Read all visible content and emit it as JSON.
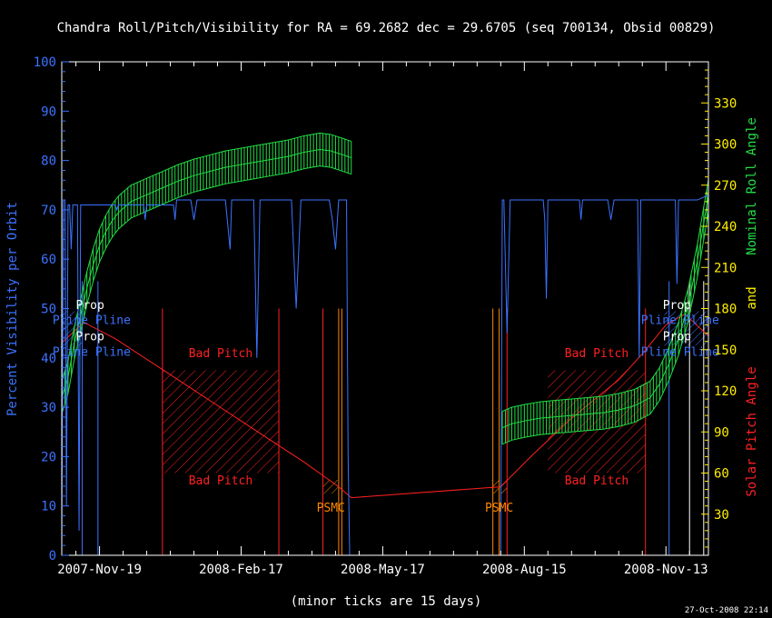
{
  "chart_data": {
    "type": "line",
    "title": "Chandra Roll/Pitch/Visibility for RA = 69.2682 dec = 29.6705 (seq 700134, Obsid 00829)",
    "xlabel": "(minor ticks are 15 days)",
    "ylabel_left": "Percent Visibility per Orbit",
    "ylabel_right_1": "Nominal Roll Angle",
    "ylabel_right_2": "and",
    "ylabel_right_3": "Solar Pitch Angle",
    "timestamp": "27-Oct-2008 22:14",
    "x_range_days": [
      -24,
      387
    ],
    "x_ticks": [
      {
        "label": "2007-Nov-19",
        "day": 0
      },
      {
        "label": "2008-Feb-17",
        "day": 90
      },
      {
        "label": "2008-May-17",
        "day": 180
      },
      {
        "label": "2008-Aug-15",
        "day": 270
      },
      {
        "label": "2008-Nov-13",
        "day": 360
      }
    ],
    "y_left": {
      "range": [
        0,
        100
      ],
      "ticks": [
        0,
        10,
        20,
        30,
        40,
        50,
        60,
        70,
        80,
        90,
        100
      ]
    },
    "y_right": {
      "range": [
        0,
        360
      ],
      "ticks": [
        30,
        60,
        90,
        120,
        150,
        180,
        210,
        240,
        270,
        300,
        330
      ]
    },
    "colors": {
      "axes": "#ffffff",
      "visibility": "#3b73ff",
      "roll": "#22dd44",
      "right_ticks": "#ffee00",
      "pitch": "#ff2020",
      "psmc": "#ff8800",
      "prop": "#ffffff",
      "pline": "#3b73ff"
    },
    "series": [
      {
        "name": "Percent Visibility per Orbit",
        "axis": "left",
        "points": [
          [
            -24,
            0
          ],
          [
            -23,
            72
          ],
          [
            -22,
            72
          ],
          [
            -21,
            10
          ],
          [
            -20,
            71
          ],
          [
            -19,
            71
          ],
          [
            -18,
            62
          ],
          [
            -17,
            71
          ],
          [
            -14,
            71
          ],
          [
            -13,
            5
          ],
          [
            -12,
            71
          ],
          [
            10,
            71
          ],
          [
            11,
            70
          ],
          [
            12,
            71
          ],
          [
            28,
            71
          ],
          [
            29,
            68
          ],
          [
            30,
            71
          ],
          [
            47,
            71
          ],
          [
            48,
            68
          ],
          [
            49,
            72
          ],
          [
            58,
            72
          ],
          [
            60,
            68
          ],
          [
            62,
            72
          ],
          [
            80,
            72
          ],
          [
            83,
            62
          ],
          [
            84,
            72
          ],
          [
            98,
            72
          ],
          [
            100,
            40
          ],
          [
            102,
            72
          ],
          [
            122,
            72
          ],
          [
            125,
            50
          ],
          [
            128,
            72
          ],
          [
            146,
            72
          ],
          [
            148,
            68
          ],
          [
            150,
            62
          ],
          [
            152,
            72
          ],
          [
            157,
            72
          ],
          [
            158,
            20
          ],
          [
            159,
            0
          ],
          [
            160,
            0
          ],
          [
            255,
            0
          ],
          [
            256,
            72
          ],
          [
            257,
            72
          ],
          [
            259,
            45
          ],
          [
            261,
            72
          ],
          [
            265,
            72
          ],
          [
            267,
            72
          ],
          [
            282,
            72
          ],
          [
            283,
            68
          ],
          [
            284,
            52
          ],
          [
            285,
            72
          ],
          [
            305,
            72
          ],
          [
            306,
            68
          ],
          [
            307,
            72
          ],
          [
            323,
            72
          ],
          [
            325,
            68
          ],
          [
            327,
            72
          ],
          [
            342,
            72
          ],
          [
            343,
            40
          ],
          [
            344,
            72
          ],
          [
            366,
            72
          ],
          [
            367,
            55
          ],
          [
            368,
            72
          ],
          [
            372,
            72
          ],
          [
            380,
            72
          ],
          [
            387,
            73
          ]
        ]
      },
      {
        "name": "Nominal Roll Angle",
        "axis": "right",
        "points": [
          [
            -24,
            115
          ],
          [
            -20,
            130
          ],
          [
            -16,
            155
          ],
          [
            -12,
            175
          ],
          [
            -8,
            195
          ],
          [
            -4,
            212
          ],
          [
            0,
            226
          ],
          [
            4,
            236
          ],
          [
            8,
            244
          ],
          [
            12,
            250
          ],
          [
            16,
            254
          ],
          [
            20,
            258
          ],
          [
            30,
            263
          ],
          [
            40,
            268
          ],
          [
            50,
            273
          ],
          [
            60,
            277
          ],
          [
            70,
            280
          ],
          [
            80,
            283
          ],
          [
            90,
            285
          ],
          [
            100,
            287
          ],
          [
            110,
            289
          ],
          [
            120,
            291
          ],
          [
            130,
            294
          ],
          [
            140,
            296
          ],
          [
            147,
            295
          ],
          [
            155,
            292
          ],
          [
            160,
            290
          ],
          [
            256,
            93
          ],
          [
            262,
            96
          ],
          [
            270,
            98
          ],
          [
            280,
            100
          ],
          [
            290,
            101
          ],
          [
            300,
            102
          ],
          [
            310,
            103
          ],
          [
            320,
            104
          ],
          [
            330,
            106
          ],
          [
            340,
            109
          ],
          [
            350,
            115
          ],
          [
            356,
            125
          ],
          [
            362,
            140
          ],
          [
            368,
            158
          ],
          [
            374,
            182
          ],
          [
            380,
            215
          ],
          [
            384,
            242
          ],
          [
            387,
            262
          ]
        ],
        "error_halfwidth_deg": 12
      },
      {
        "name": "Solar Pitch Angle",
        "axis": "right",
        "points": [
          [
            -24,
            155
          ],
          [
            -10,
            170
          ],
          [
            10,
            158
          ],
          [
            50,
            128
          ],
          [
            90,
            98
          ],
          [
            130,
            68
          ],
          [
            152,
            50
          ],
          [
            160,
            42
          ],
          [
            255,
            50
          ],
          [
            275,
            73
          ],
          [
            300,
            100
          ],
          [
            330,
            128
          ],
          [
            345,
            147
          ],
          [
            360,
            168
          ],
          [
            372,
            176
          ],
          [
            387,
            160
          ]
        ]
      }
    ],
    "regions": [
      {
        "label": "Bad Pitch",
        "day_start": 40,
        "day_end": 114,
        "deg_low": 60,
        "deg_high": 135,
        "kind": "hatch"
      },
      {
        "label": "Bad Pitch",
        "day_start": 285,
        "day_end": 347,
        "deg_low": 60,
        "deg_high": 135,
        "kind": "hatch"
      },
      {
        "label": "PSMC",
        "day_start": 142,
        "day_end": 152,
        "deg_low": 45,
        "deg_high": 55,
        "kind": "hatch"
      },
      {
        "label": "PSMC",
        "day_start": 249,
        "day_end": 259,
        "deg_low": 45,
        "deg_high": 55,
        "kind": "hatch"
      },
      {
        "label": "Pline",
        "day_start": -24,
        "day_end": -11,
        "deg_low": 153,
        "deg_high": 178,
        "kind": "hatch"
      },
      {
        "label": "Pline",
        "day_start": 359,
        "day_end": 387,
        "deg_low": 153,
        "deg_high": 178,
        "kind": "hatch"
      }
    ],
    "vlines": [
      {
        "day": -11,
        "color": "#3b73ff"
      },
      {
        "day": -1,
        "color": "#3b73ff"
      },
      {
        "day": 40,
        "color": "#ff2020"
      },
      {
        "day": 114,
        "color": "#ff2020"
      },
      {
        "day": 142,
        "color": "#ff2020"
      },
      {
        "day": 152,
        "color": "#ff8800"
      },
      {
        "day": 154,
        "color": "#ff8800"
      },
      {
        "day": 250,
        "color": "#ff8800"
      },
      {
        "day": 254,
        "color": "#ff8800"
      },
      {
        "day": 259,
        "color": "#ff2020"
      },
      {
        "day": 347,
        "color": "#ff2020"
      },
      {
        "day": 362,
        "color": "#3b73ff"
      },
      {
        "day": 375,
        "color": "#ffffff"
      },
      {
        "day": 384,
        "color": "#ffffff"
      }
    ],
    "annotations": [
      {
        "text": "Bad Pitch",
        "day": 77,
        "deg": 148,
        "color": "#ff2020"
      },
      {
        "text": "Bad Pitch",
        "day": 77,
        "deg": 55,
        "color": "#ff2020"
      },
      {
        "text": "Bad Pitch",
        "day": 316,
        "deg": 148,
        "color": "#ff2020"
      },
      {
        "text": "Bad Pitch",
        "day": 316,
        "deg": 55,
        "color": "#ff2020"
      },
      {
        "text": "PSMC",
        "day": 147,
        "deg": 35,
        "color": "#ff8800"
      },
      {
        "text": "PSMC",
        "day": 254,
        "deg": 35,
        "color": "#ff8800"
      },
      {
        "text": "Prop",
        "day": -6,
        "deg": 183,
        "color": "#ffffff"
      },
      {
        "text": "Prop",
        "day": -6,
        "deg": 160,
        "color": "#ffffff"
      },
      {
        "text": "Prop",
        "day": 367,
        "deg": 183,
        "color": "#ffffff"
      },
      {
        "text": "Prop",
        "day": 367,
        "deg": 160,
        "color": "#ffffff"
      },
      {
        "text": "Pline Pline",
        "day": -5,
        "deg": 172,
        "color": "#3b73ff"
      },
      {
        "text": "Pline Pline",
        "day": -5,
        "deg": 149,
        "color": "#3b73ff"
      },
      {
        "text": "Pline Pline",
        "day": 369,
        "deg": 172,
        "color": "#3b73ff"
      },
      {
        "text": "Pline Pline",
        "day": 369,
        "deg": 149,
        "color": "#3b73ff"
      }
    ]
  }
}
